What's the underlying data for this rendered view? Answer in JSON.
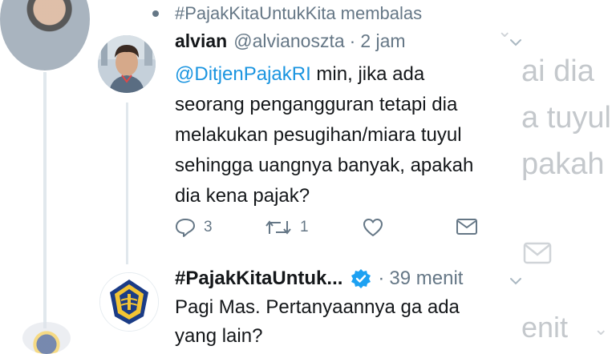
{
  "retweet_header": {
    "text": "#PajakKitaUntukKita membalas"
  },
  "tweet1": {
    "author_name": "alvian",
    "handle": "@alvianoszta",
    "separator": "·",
    "time": "2 jam",
    "mention": "@DitjenPajakRI",
    "body_line1_rest": " min, jika ada",
    "body_line2": "seorang pengangguran tetapi dia",
    "body_line3": "melakukan pesugihan/miara tuyul",
    "body_line4": "sehingga uangnya banyak, apakah",
    "body_line5": "dia kena pajak?",
    "reply_count": "3",
    "retweet_count": "1",
    "icons": [
      "reply-icon",
      "retweet-icon",
      "like-icon",
      "direct-message-icon",
      "chevron-down-icon"
    ]
  },
  "tweet2": {
    "author_name": "#PajakKitaUntuk...",
    "separator": "·",
    "time": "39 menit",
    "body_line1": "Pagi Mas. Pertanyaannya ga ada",
    "body_line2": "yang lain?",
    "icons": [
      "verified-badge-icon",
      "chevron-down-icon"
    ]
  },
  "background_ghost": {
    "line1": "ai dia",
    "line2": "a tuyul",
    "line3": "pakah",
    "time": "enit"
  },
  "colors": {
    "text": "#14171a",
    "secondary": "#657786",
    "link": "#1b95e0",
    "verified": "#1da1f2",
    "faded": "#c4c8cc"
  }
}
